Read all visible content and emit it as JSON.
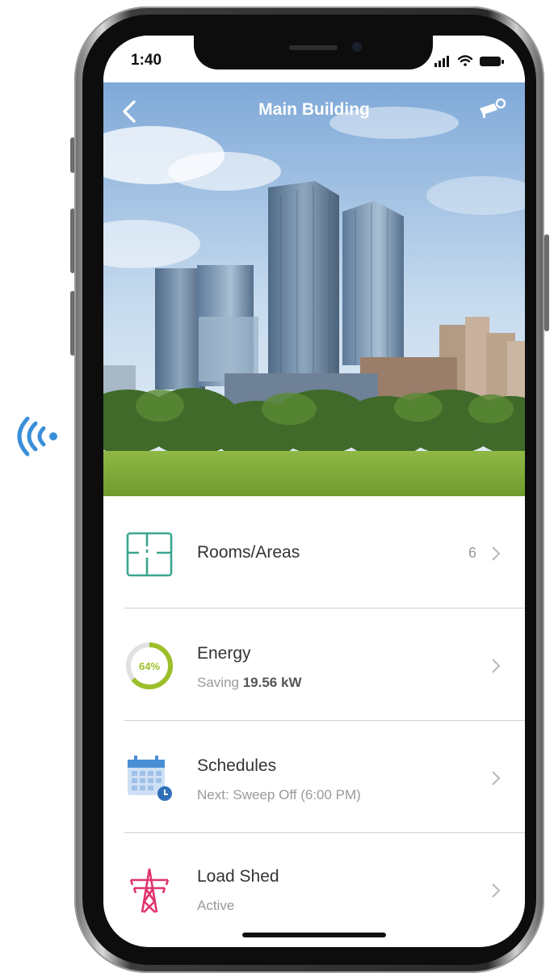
{
  "status_bar": {
    "time": "1:40"
  },
  "header": {
    "title": "Main Building"
  },
  "icons": {
    "signal": "wireless-signal-icon",
    "back": "chevron-left-icon",
    "camera": "security-camera-icon",
    "rooms": "floorplan-icon",
    "energy": "gauge-ring-icon",
    "schedules": "calendar-clock-icon",
    "load_shed": "power-tower-icon",
    "chevron": "chevron-right-icon"
  },
  "menu": {
    "rooms": {
      "label": "Rooms/Areas",
      "count": "6"
    },
    "energy": {
      "label": "Energy",
      "percent_label": "64%",
      "percent": 64,
      "sub_prefix": "Saving",
      "sub_value": "19.56 kW"
    },
    "schedules": {
      "label": "Schedules",
      "sub": "Next: Sweep Off (6:00 PM)"
    },
    "load_shed": {
      "label": "Load Shed",
      "sub": "Active"
    }
  },
  "colors": {
    "signal_blue": "#3a8fd8",
    "rooms_teal": "#3aa58f",
    "energy_green": "#9cbf2a",
    "schedules_blue": "#4a8fd6",
    "load_shed_pink": "#e0336b"
  }
}
